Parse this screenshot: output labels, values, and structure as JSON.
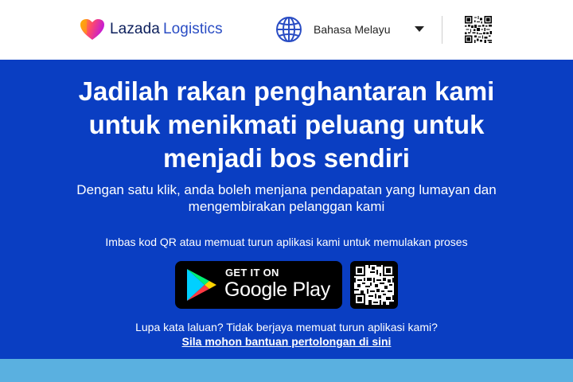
{
  "header": {
    "brand_name": "Lazada",
    "brand_suffix": "Logistics",
    "language_selected": "Bahasa Melayu",
    "icons": {
      "globe": "globe-icon",
      "caret": "caret-down-icon",
      "qr": "qr-code-icon"
    },
    "colors": {
      "brand_dark": "#0c1f5c",
      "brand_blue": "#2a4dc4"
    }
  },
  "hero": {
    "title": "Jadilah rakan penghantaran kami untuk menikmati peluang untuk menjadi bos sendiri",
    "subtitle": "Dengan satu klik, anda boleh menjana pendapatan yang lumayan dan mengembirakan pelanggan kami",
    "instruction": "Imbas kod QR atau memuat turun aplikasi kami untuk memulakan proses",
    "google_play_small": "GET IT ON",
    "google_play_big": "Google Play",
    "help_text": "Lupa kata laluan? Tidak berjaya memuat turun aplikasi kami?",
    "help_link": "Sila mohon bantuan pertolongan di sini",
    "colors": {
      "background": "#0a3ec2",
      "text": "#ffffff"
    }
  },
  "footer_band": {
    "color": "#5ab0e0"
  }
}
